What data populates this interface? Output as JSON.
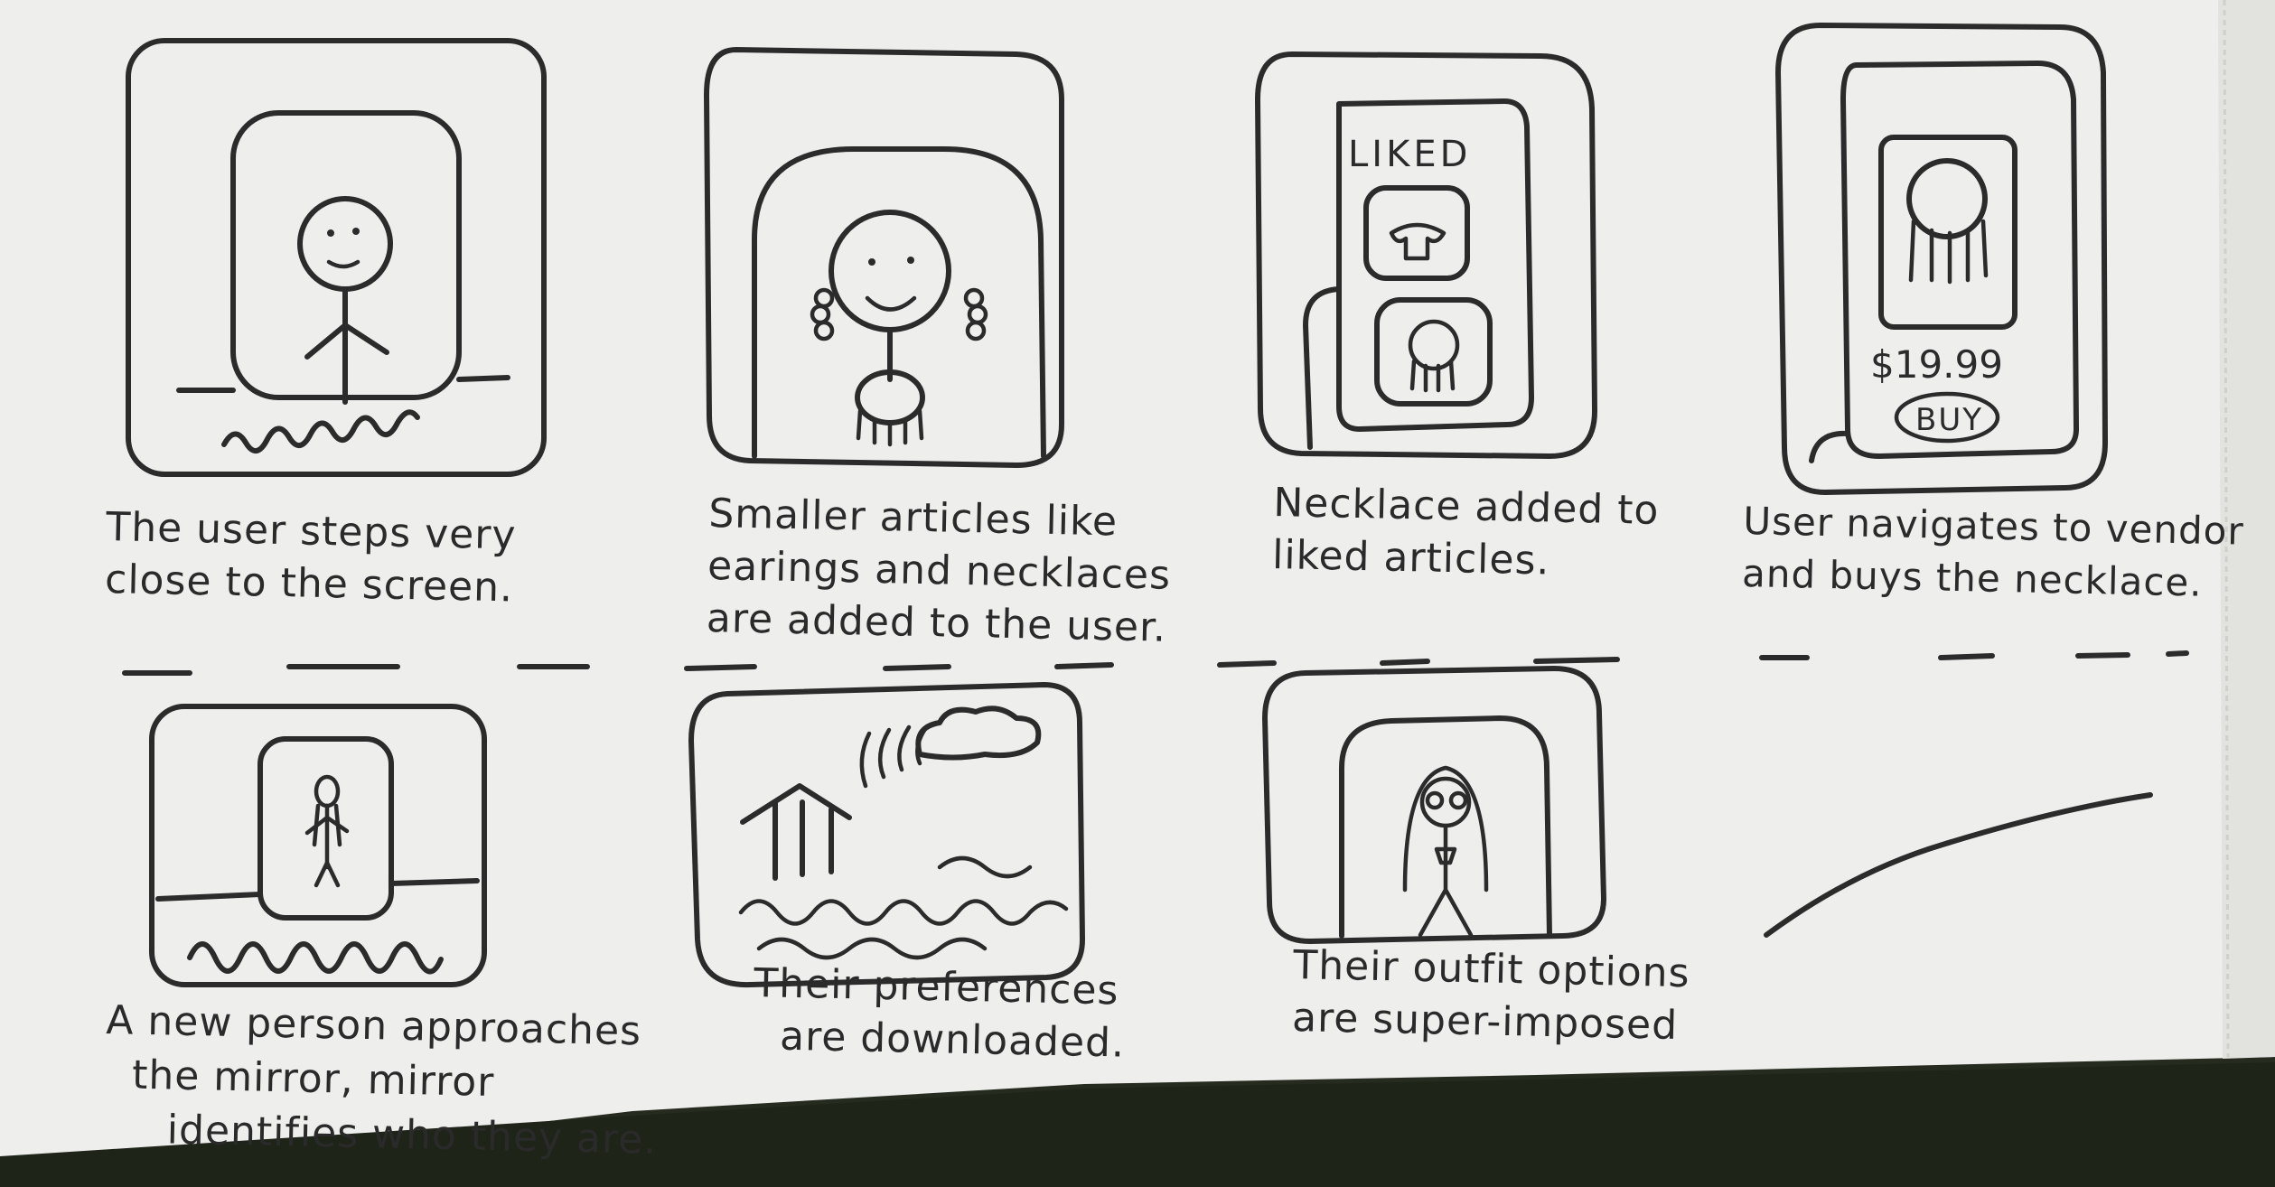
{
  "storyboard": {
    "panels": [
      {
        "caption_lines": [
          "The user steps very",
          "close to the screen."
        ]
      },
      {
        "caption_lines": [
          "Smaller articles like",
          "earings and necklaces",
          "are added to the user."
        ]
      },
      {
        "caption_lines": [
          "Necklace added to",
          "liked articles."
        ],
        "screen_label": "LIKED"
      },
      {
        "caption_lines": [
          "User navigates to vendor",
          "and buys the necklace."
        ],
        "price": "$19.99",
        "buy_label": "BUY"
      },
      {
        "caption_lines": [
          "A new person approaches",
          "the mirror, mirror",
          "identifies who they are."
        ]
      },
      {
        "caption_lines": [
          "Their preferences",
          "are downloaded."
        ]
      },
      {
        "caption_lines": [
          "Their outfit options",
          "are super-imposed"
        ]
      }
    ]
  },
  "colors": {
    "paper": "#eeeeec",
    "ink": "#2b2b2b",
    "background": "#262b1f"
  }
}
